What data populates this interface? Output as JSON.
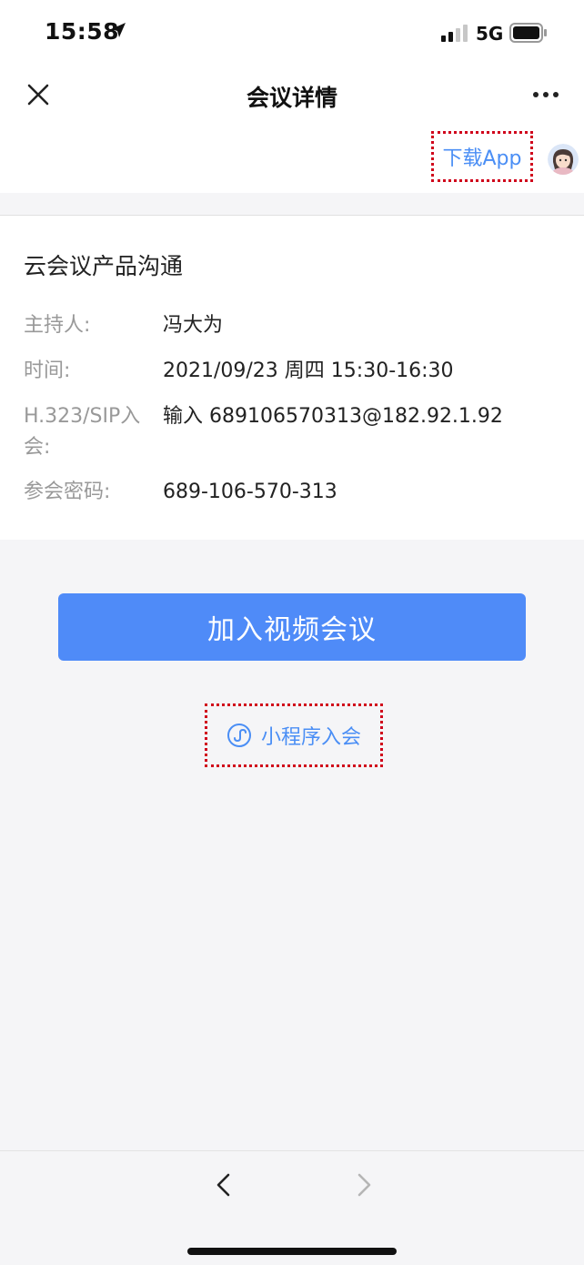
{
  "status": {
    "time": "15:58",
    "network": "5G",
    "icons": [
      "location-arrow-icon",
      "signal-icon",
      "battery-icon"
    ]
  },
  "nav": {
    "title": "会议详情",
    "close_icon": "close-icon",
    "more_icon": "more-icon"
  },
  "app": {
    "download_label": "下载App",
    "avatar_icon": "avatar"
  },
  "meeting": {
    "title": "云会议产品沟通",
    "host_label": "主持人:",
    "host_value": "冯大为",
    "time_label": "时间:",
    "time_value": "2021/09/23 周四 15:30-16:30",
    "sip_label_line1": "H.323/SIP入",
    "sip_label_line2": "会:",
    "sip_value": "输入 689106570313@182.92.1.92",
    "pwd_label": "参会密码:",
    "pwd_value": "689-106-570-313"
  },
  "actions": {
    "join_label": "加入视频会议",
    "mini_label": "小程序入会",
    "mini_icon": "mini-program-icon"
  },
  "colors": {
    "accent": "#4f8bf8",
    "link": "#4a8ef5",
    "highlight": "#d0021b",
    "background": "#f5f5f7"
  }
}
